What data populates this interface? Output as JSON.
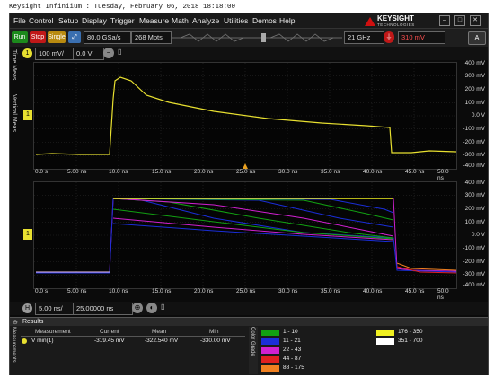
{
  "title_bar": "Keysight Infiniium : Tuesday, February 06, 2018 18:18:00",
  "menu": [
    "File",
    "Control",
    "Setup",
    "Display",
    "Trigger",
    "Measure",
    "Math",
    "Analyze",
    "Utilities",
    "Demos",
    "Help"
  ],
  "logo": {
    "name": "KEYSIGHT",
    "sub": "TECHNOLOGIES"
  },
  "toolbar": {
    "run": "Run",
    "stop": "Stop",
    "single": "Single",
    "sample_rate": "80.0 GSa/s",
    "memory": "268 Mpts",
    "bandwidth": "21 GHz",
    "trigger_level": "310 mV"
  },
  "channel": {
    "number": "1",
    "scale": "100 mV/",
    "offset": "0.0 V"
  },
  "side_tabs": {
    "time": "Time Meas",
    "vertical": "Vertical Meas"
  },
  "vertical_labels": [
    "400 mV",
    "300 mV",
    "200 mV",
    "100 mV",
    "0.0 V",
    "-100 mV",
    "-200 mV",
    "-300 mV",
    "-400 mV"
  ],
  "time_labels": [
    "0.0 s",
    "5.00 ns",
    "10.0 ns",
    "15.0 ns",
    "20.0 ns",
    "25.0 ns",
    "30.0 ns",
    "35.0 ns",
    "40.0 ns",
    "45.0 ns",
    "50.0 ns"
  ],
  "timebase": {
    "scale": "5.00 ns/",
    "position": "25.00000 ns"
  },
  "results": {
    "tab": "Results",
    "side": "Measurements",
    "headers": [
      "Measurement",
      "Current",
      "Mean",
      "Min"
    ],
    "row": {
      "name": "V min(1)",
      "current": "-319.45 mV",
      "mean": "-322.540 mV",
      "min": "-330.00 mV"
    }
  },
  "color_grade": {
    "tab": "Color Grade",
    "bins": [
      {
        "label": "1 - 10",
        "color": "#12a012"
      },
      {
        "label": "11 - 21",
        "color": "#1a2ed8"
      },
      {
        "label": "22 - 43",
        "color": "#d020d0"
      },
      {
        "label": "44 - 87",
        "color": "#e02020"
      },
      {
        "label": "88 - 175",
        "color": "#f08020"
      },
      {
        "label": "176 - 350",
        "color": "#f0f020"
      },
      {
        "label": "351 - 700",
        "color": "#ffffff"
      }
    ]
  },
  "colors": {
    "trace": "#e8e030",
    "accent": "#d01010"
  }
}
